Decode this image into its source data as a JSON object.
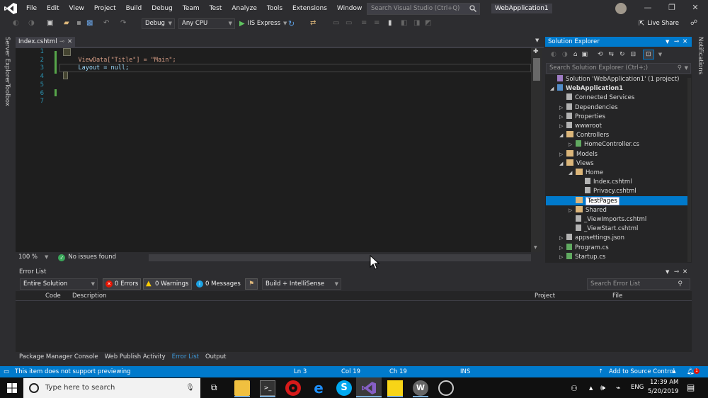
{
  "menu": [
    "File",
    "Edit",
    "View",
    "Project",
    "Build",
    "Debug",
    "Team",
    "Test",
    "Analyze",
    "Tools",
    "Extensions",
    "Window",
    "Help"
  ],
  "search": {
    "placeholder": "Search Visual Studio (Ctrl+Q)"
  },
  "project_name": "WebApplication1",
  "toolbar": {
    "config": "Debug",
    "platform": "Any CPU",
    "run_label": "IIS Express",
    "live_share": "Live Share"
  },
  "left_tabs": [
    "Server Explorer",
    "Toolbox"
  ],
  "right_tabs": [
    "Notifications"
  ],
  "editor": {
    "tab_title": "Index.cshtml",
    "line_numbers": [
      "1",
      "2",
      "3",
      "4",
      "5",
      "6",
      "7"
    ],
    "code_lines": [
      "@{",
      "    ViewData[\"Title\"] = \"Main\";",
      "    Layout = null;",
      "}",
      "",
      "",
      ""
    ],
    "zoom": "100 %",
    "issues": "No issues found"
  },
  "solution_explorer": {
    "title": "Solution Explorer",
    "search_placeholder": "Search Solution Explorer (Ctrl+;)",
    "items": [
      {
        "label": "Solution 'WebApplication1' (1 project)",
        "indent": 0,
        "twisty": "",
        "icon": "solution-icon",
        "bold": false
      },
      {
        "label": "WebApplication1",
        "indent": 0,
        "twisty": "◢",
        "icon": "project-icon",
        "bold": true
      },
      {
        "label": "Connected Services",
        "indent": 1,
        "twisty": "",
        "icon": "connected-services-icon",
        "bold": false
      },
      {
        "label": "Dependencies",
        "indent": 1,
        "twisty": "▷",
        "icon": "dependencies-icon",
        "bold": false
      },
      {
        "label": "Properties",
        "indent": 1,
        "twisty": "▷",
        "icon": "wrench-icon",
        "bold": false
      },
      {
        "label": "wwwroot",
        "indent": 1,
        "twisty": "▷",
        "icon": "globe-icon",
        "bold": false
      },
      {
        "label": "Controllers",
        "indent": 1,
        "twisty": "◢",
        "icon": "folder-icon",
        "bold": false
      },
      {
        "label": "HomeController.cs",
        "indent": 2,
        "twisty": "▷",
        "icon": "csharp-file-icon",
        "bold": false
      },
      {
        "label": "Models",
        "indent": 1,
        "twisty": "▷",
        "icon": "folder-icon",
        "bold": false
      },
      {
        "label": "Views",
        "indent": 1,
        "twisty": "◢",
        "icon": "folder-icon",
        "bold": false
      },
      {
        "label": "Home",
        "indent": 2,
        "twisty": "◢",
        "icon": "folder-icon",
        "bold": false
      },
      {
        "label": "Index.cshtml",
        "indent": 3,
        "twisty": "",
        "icon": "razor-file-icon",
        "bold": false
      },
      {
        "label": "Privacy.cshtml",
        "indent": 3,
        "twisty": "",
        "icon": "razor-file-icon",
        "bold": false
      },
      {
        "label": "TestPages",
        "indent": 2,
        "twisty": "",
        "icon": "folder-icon",
        "bold": false,
        "renaming": true
      },
      {
        "label": "Shared",
        "indent": 2,
        "twisty": "▷",
        "icon": "folder-icon",
        "bold": false
      },
      {
        "label": "_ViewImports.cshtml",
        "indent": 2,
        "twisty": "",
        "icon": "razor-file-icon",
        "bold": false
      },
      {
        "label": "_ViewStart.cshtml",
        "indent": 2,
        "twisty": "",
        "icon": "razor-file-icon",
        "bold": false
      },
      {
        "label": "appsettings.json",
        "indent": 1,
        "twisty": "▷",
        "icon": "json-file-icon",
        "bold": false
      },
      {
        "label": "Program.cs",
        "indent": 1,
        "twisty": "▷",
        "icon": "csharp-file-icon",
        "bold": false
      },
      {
        "label": "Startup.cs",
        "indent": 1,
        "twisty": "▷",
        "icon": "csharp-file-icon",
        "bold": false
      }
    ]
  },
  "error_list": {
    "title": "Error List",
    "scope": "Entire Solution",
    "errors": "0 Errors",
    "warnings": "0 Warnings",
    "messages": "0 Messages",
    "build_filter": "Build + IntelliSense",
    "search_placeholder": "Search Error List",
    "columns": [
      "Code",
      "Description",
      "Project",
      "File"
    ]
  },
  "bottom_tabs": [
    "Package Manager Console",
    "Web Publish Activity",
    "Error List",
    "Output"
  ],
  "statusbar": {
    "message": "This item does not support previewing",
    "ln": "Ln 3",
    "col": "Col 19",
    "ch": "Ch 19",
    "mode": "INS",
    "source_control": "Add to Source Control",
    "notif_count": "1"
  },
  "taskbar": {
    "search_placeholder": "Type here to search",
    "language": "ENG",
    "time": "12:39 AM",
    "date": "5/20/2019"
  },
  "colors": {
    "accent": "#007acc",
    "bg": "#2d2d30",
    "editor": "#1e1e1e",
    "vs_purple": "#865fc5"
  }
}
